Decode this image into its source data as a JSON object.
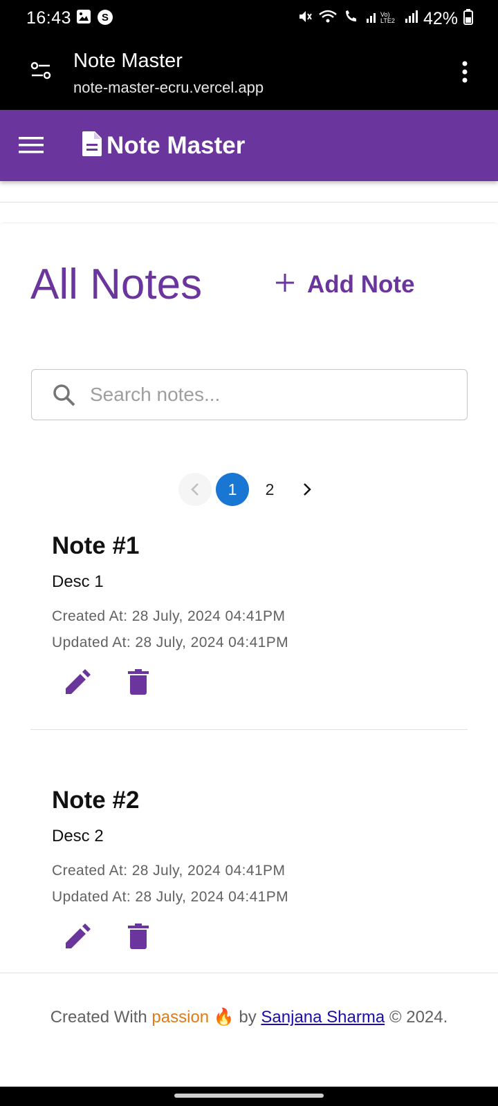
{
  "status_bar": {
    "time": "16:43",
    "battery": "42%"
  },
  "browser": {
    "title": "Note Master",
    "url": "note-master-ecru.vercel.app"
  },
  "app_bar": {
    "title": "Note Master"
  },
  "main": {
    "heading": "All Notes",
    "add_note_label": "Add Note",
    "search": {
      "placeholder": "Search notes...",
      "value": ""
    }
  },
  "pagination": {
    "current": "1",
    "pages": [
      "1",
      "2"
    ]
  },
  "notes": [
    {
      "title": "Note #1",
      "description": "Desc 1",
      "created": "Created At: 28 July, 2024 04:41PM",
      "updated": "Updated At: 28 July, 2024 04:41PM"
    },
    {
      "title": "Note #2",
      "description": "Desc 2",
      "created": "Created At: 28 July, 2024 04:41PM",
      "updated": "Updated At: 28 July, 2024 04:41PM"
    }
  ],
  "footer": {
    "prefix": "Created With",
    "passion": "passion",
    "emoji": "🔥",
    "by": "by",
    "author": "Sanjana Sharma",
    "suffix": "© 2024."
  },
  "colors": {
    "brand": "#6a359c",
    "active_page": "#1976d2",
    "passion": "#e07b16",
    "link": "#1a0dab"
  },
  "icons": [
    "image-icon",
    "s-app-icon",
    "mute-icon",
    "wifi-icon",
    "call-icon",
    "signal-icon",
    "battery-icon",
    "site-settings-icon",
    "more-vert-icon",
    "menu-icon",
    "document-icon",
    "plus-icon",
    "search-icon",
    "chevron-left-icon",
    "chevron-right-icon",
    "edit-icon",
    "delete-icon"
  ]
}
